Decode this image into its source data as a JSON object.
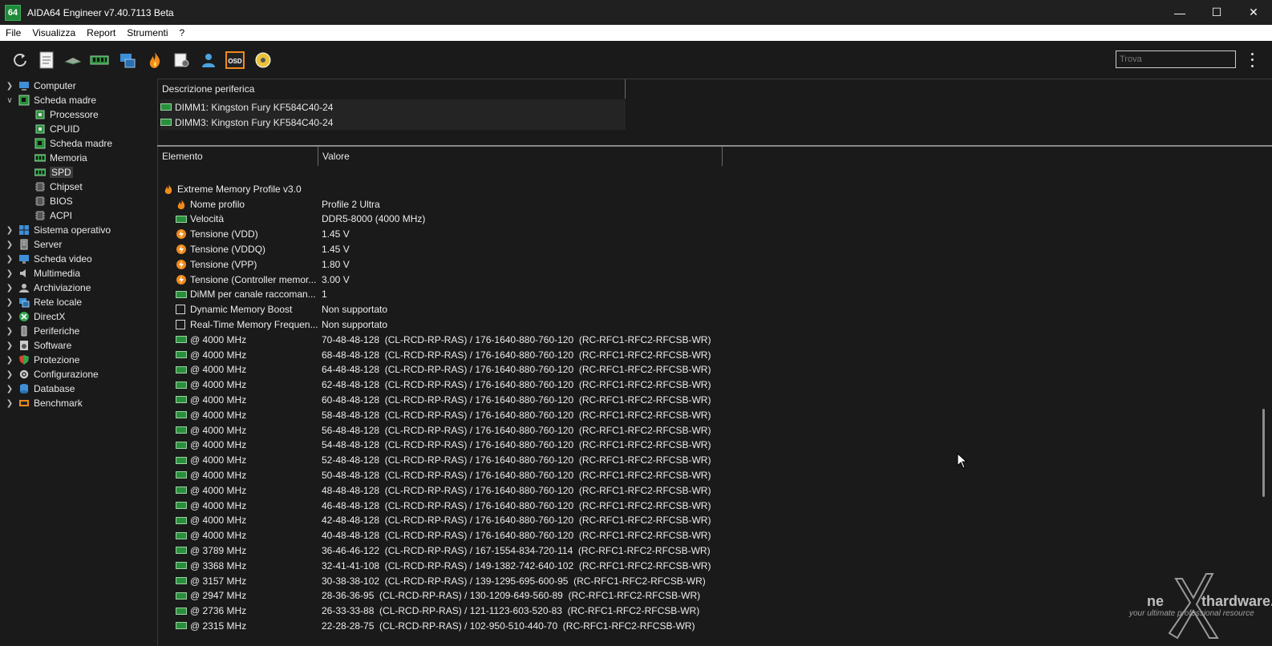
{
  "window": {
    "app_logo": "64",
    "title": "AIDA64 Engineer v7.40.7113 Beta",
    "minimize": "—",
    "maximize": "☐",
    "close": "✕"
  },
  "menu": [
    "File",
    "Visualizza",
    "Report",
    "Strumenti",
    "?"
  ],
  "toolbar": {
    "icons": [
      "refresh-icon",
      "report-icon",
      "memory-stick-icon",
      "ram-module-icon",
      "network-monitor-icon",
      "flame-icon",
      "settings-list-icon",
      "users-icon",
      "osd-icon",
      "audio-disc-icon"
    ],
    "osd_label": "OSD",
    "search_placeholder": "Trova"
  },
  "sidebar": {
    "items": [
      {
        "label": "Computer",
        "expanded": false,
        "level": 0
      },
      {
        "label": "Scheda madre",
        "expanded": true,
        "level": 0
      },
      {
        "label": "Processore",
        "level": 1
      },
      {
        "label": "CPUID",
        "level": 1
      },
      {
        "label": "Scheda madre",
        "level": 1
      },
      {
        "label": "Memoria",
        "level": 1
      },
      {
        "label": "SPD",
        "level": 1,
        "selected": true
      },
      {
        "label": "Chipset",
        "level": 1
      },
      {
        "label": "BIOS",
        "level": 1
      },
      {
        "label": "ACPI",
        "level": 1
      },
      {
        "label": "Sistema operativo",
        "expanded": false,
        "level": 0
      },
      {
        "label": "Server",
        "expanded": false,
        "level": 0
      },
      {
        "label": "Scheda video",
        "expanded": false,
        "level": 0
      },
      {
        "label": "Multimedia",
        "expanded": false,
        "level": 0
      },
      {
        "label": "Archiviazione",
        "expanded": false,
        "level": 0
      },
      {
        "label": "Rete locale",
        "expanded": false,
        "level": 0
      },
      {
        "label": "DirectX",
        "expanded": false,
        "level": 0
      },
      {
        "label": "Periferiche",
        "expanded": false,
        "level": 0
      },
      {
        "label": "Software",
        "expanded": false,
        "level": 0
      },
      {
        "label": "Protezione",
        "expanded": false,
        "level": 0
      },
      {
        "label": "Configurazione",
        "expanded": false,
        "level": 0
      },
      {
        "label": "Database",
        "expanded": false,
        "level": 0
      },
      {
        "label": "Benchmark",
        "expanded": false,
        "level": 0
      }
    ]
  },
  "devices": {
    "header": "Descrizione periferica",
    "items": [
      "DIMM1: Kingston Fury KF584C40-24",
      "DIMM3: Kingston Fury KF584C40-24"
    ]
  },
  "details": {
    "col_element": "Elemento",
    "col_value": "Valore",
    "section": "Extreme Memory Profile v3.0",
    "rows": [
      {
        "el": "Nome profilo",
        "val": "Profile 2 Ultra",
        "icon": "flame"
      },
      {
        "el": "Velocità",
        "val": "DDR5-8000 (4000 MHz)",
        "icon": "mem"
      },
      {
        "el": "Tensione (VDD)",
        "val": "1.45 V",
        "icon": "volt"
      },
      {
        "el": "Tensione (VDDQ)",
        "val": "1.45 V",
        "icon": "volt"
      },
      {
        "el": "Tensione (VPP)",
        "val": "1.80 V",
        "icon": "volt"
      },
      {
        "el": "Tensione (Controller memor...",
        "val": "3.00 V",
        "icon": "volt"
      },
      {
        "el": "DiMM per canale raccoman...",
        "val": "1",
        "icon": "mem"
      },
      {
        "el": "Dynamic Memory Boost",
        "val": "Non supportato",
        "icon": "checkbox"
      },
      {
        "el": "Real-Time Memory Frequen...",
        "val": "Non supportato",
        "icon": "checkbox"
      },
      {
        "el": "@ 4000 MHz",
        "val": "70-48-48-128  (CL-RCD-RP-RAS) / 176-1640-880-760-120  (RC-RFC1-RFC2-RFCSB-WR)",
        "icon": "mem"
      },
      {
        "el": "@ 4000 MHz",
        "val": "68-48-48-128  (CL-RCD-RP-RAS) / 176-1640-880-760-120  (RC-RFC1-RFC2-RFCSB-WR)",
        "icon": "mem"
      },
      {
        "el": "@ 4000 MHz",
        "val": "64-48-48-128  (CL-RCD-RP-RAS) / 176-1640-880-760-120  (RC-RFC1-RFC2-RFCSB-WR)",
        "icon": "mem"
      },
      {
        "el": "@ 4000 MHz",
        "val": "62-48-48-128  (CL-RCD-RP-RAS) / 176-1640-880-760-120  (RC-RFC1-RFC2-RFCSB-WR)",
        "icon": "mem"
      },
      {
        "el": "@ 4000 MHz",
        "val": "60-48-48-128  (CL-RCD-RP-RAS) / 176-1640-880-760-120  (RC-RFC1-RFC2-RFCSB-WR)",
        "icon": "mem"
      },
      {
        "el": "@ 4000 MHz",
        "val": "58-48-48-128  (CL-RCD-RP-RAS) / 176-1640-880-760-120  (RC-RFC1-RFC2-RFCSB-WR)",
        "icon": "mem"
      },
      {
        "el": "@ 4000 MHz",
        "val": "56-48-48-128  (CL-RCD-RP-RAS) / 176-1640-880-760-120  (RC-RFC1-RFC2-RFCSB-WR)",
        "icon": "mem"
      },
      {
        "el": "@ 4000 MHz",
        "val": "54-48-48-128  (CL-RCD-RP-RAS) / 176-1640-880-760-120  (RC-RFC1-RFC2-RFCSB-WR)",
        "icon": "mem"
      },
      {
        "el": "@ 4000 MHz",
        "val": "52-48-48-128  (CL-RCD-RP-RAS) / 176-1640-880-760-120  (RC-RFC1-RFC2-RFCSB-WR)",
        "icon": "mem"
      },
      {
        "el": "@ 4000 MHz",
        "val": "50-48-48-128  (CL-RCD-RP-RAS) / 176-1640-880-760-120  (RC-RFC1-RFC2-RFCSB-WR)",
        "icon": "mem"
      },
      {
        "el": "@ 4000 MHz",
        "val": "48-48-48-128  (CL-RCD-RP-RAS) / 176-1640-880-760-120  (RC-RFC1-RFC2-RFCSB-WR)",
        "icon": "mem"
      },
      {
        "el": "@ 4000 MHz",
        "val": "46-48-48-128  (CL-RCD-RP-RAS) / 176-1640-880-760-120  (RC-RFC1-RFC2-RFCSB-WR)",
        "icon": "mem"
      },
      {
        "el": "@ 4000 MHz",
        "val": "42-48-48-128  (CL-RCD-RP-RAS) / 176-1640-880-760-120  (RC-RFC1-RFC2-RFCSB-WR)",
        "icon": "mem"
      },
      {
        "el": "@ 4000 MHz",
        "val": "40-48-48-128  (CL-RCD-RP-RAS) / 176-1640-880-760-120  (RC-RFC1-RFC2-RFCSB-WR)",
        "icon": "mem"
      },
      {
        "el": "@ 3789 MHz",
        "val": "36-46-46-122  (CL-RCD-RP-RAS) / 167-1554-834-720-114  (RC-RFC1-RFC2-RFCSB-WR)",
        "icon": "mem"
      },
      {
        "el": "@ 3368 MHz",
        "val": "32-41-41-108  (CL-RCD-RP-RAS) / 149-1382-742-640-102  (RC-RFC1-RFC2-RFCSB-WR)",
        "icon": "mem"
      },
      {
        "el": "@ 3157 MHz",
        "val": "30-38-38-102  (CL-RCD-RP-RAS) / 139-1295-695-600-95  (RC-RFC1-RFC2-RFCSB-WR)",
        "icon": "mem"
      },
      {
        "el": "@ 2947 MHz",
        "val": "28-36-36-95  (CL-RCD-RP-RAS) / 130-1209-649-560-89  (RC-RFC1-RFC2-RFCSB-WR)",
        "icon": "mem"
      },
      {
        "el": "@ 2736 MHz",
        "val": "26-33-33-88  (CL-RCD-RP-RAS) / 121-1123-603-520-83  (RC-RFC1-RFC2-RFCSB-WR)",
        "icon": "mem"
      },
      {
        "el": "@ 2315 MHz",
        "val": "22-28-28-75  (CL-RCD-RP-RAS) / 102-950-510-440-70  (RC-RFC1-RFC2-RFCSB-WR)",
        "icon": "mem"
      }
    ]
  },
  "watermark": {
    "brand_left": "ne",
    "brand_right": "thardware.com",
    "tagline": "your ultimate professional resource"
  },
  "colors": {
    "background": "#1a1a1a",
    "titlebar": "#202020",
    "menubar": "#ffffff",
    "accent_green": "#2a8f3c",
    "flame": "#f08a1c"
  }
}
